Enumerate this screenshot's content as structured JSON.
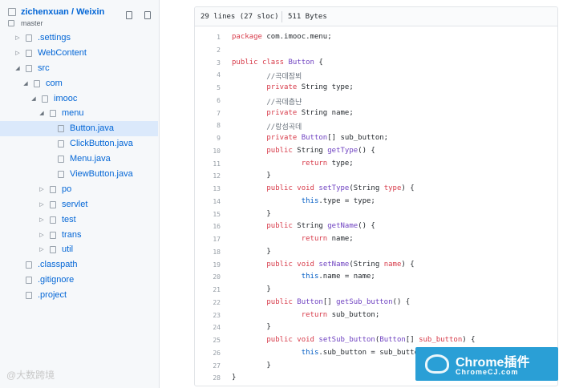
{
  "repo": {
    "title": "zichenxuan / Weixin",
    "branch": "master"
  },
  "tree": [
    {
      "label": ".settings",
      "toggle": "▷",
      "depth": 0
    },
    {
      "label": "WebContent",
      "toggle": "▷",
      "depth": 0
    },
    {
      "label": "src",
      "toggle": "◢",
      "depth": 0
    },
    {
      "label": "com",
      "toggle": "◢",
      "depth": 1
    },
    {
      "label": "imooc",
      "toggle": "◢",
      "depth": 2
    },
    {
      "label": "menu",
      "toggle": "◢",
      "depth": 3
    },
    {
      "label": "Button.java",
      "toggle": "",
      "depth": 4,
      "selected": true
    },
    {
      "label": "ClickButton.java",
      "toggle": "",
      "depth": 4
    },
    {
      "label": "Menu.java",
      "toggle": "",
      "depth": 4
    },
    {
      "label": "ViewButton.java",
      "toggle": "",
      "depth": 4
    },
    {
      "label": "po",
      "toggle": "▷",
      "depth": 3
    },
    {
      "label": "servlet",
      "toggle": "▷",
      "depth": 3
    },
    {
      "label": "test",
      "toggle": "▷",
      "depth": 3
    },
    {
      "label": "trans",
      "toggle": "▷",
      "depth": 3
    },
    {
      "label": "util",
      "toggle": "▷",
      "depth": 3
    },
    {
      "label": ".classpath",
      "toggle": "",
      "depth": 0
    },
    {
      "label": ".gitignore",
      "toggle": "",
      "depth": 0
    },
    {
      "label": ".project",
      "toggle": "",
      "depth": 0
    }
  ],
  "file": {
    "lines_info": "29 lines (27 sloc)",
    "size_info": "511 Bytes"
  },
  "code": [
    [
      [
        "kw",
        "package"
      ],
      [
        "tx",
        " com.imooc.menu;"
      ]
    ],
    [],
    [
      [
        "kw",
        "public"
      ],
      [
        "tx",
        " "
      ],
      [
        "kw",
        "class"
      ],
      [
        "tx",
        " "
      ],
      [
        "ty",
        "Button"
      ],
      [
        "tx",
        " {"
      ]
    ],
    [
      [
        "tx",
        "        "
      ],
      [
        "cm",
        "//곡데잠뵈"
      ]
    ],
    [
      [
        "tx",
        "        "
      ],
      [
        "kw",
        "private"
      ],
      [
        "tx",
        " String type;"
      ]
    ],
    [
      [
        "tx",
        "        "
      ],
      [
        "cm",
        "//곡데츰냔"
      ]
    ],
    [
      [
        "tx",
        "        "
      ],
      [
        "kw",
        "private"
      ],
      [
        "tx",
        " String name;"
      ]
    ],
    [
      [
        "tx",
        "        "
      ],
      [
        "cm",
        "//랑섬곡데"
      ]
    ],
    [
      [
        "tx",
        "        "
      ],
      [
        "kw",
        "private"
      ],
      [
        "tx",
        " "
      ],
      [
        "ty",
        "Button"
      ],
      [
        "tx",
        "[] sub_button;"
      ]
    ],
    [
      [
        "tx",
        "        "
      ],
      [
        "kw",
        "public"
      ],
      [
        "tx",
        " String "
      ],
      [
        "fn",
        "getType"
      ],
      [
        "tx",
        "() {"
      ]
    ],
    [
      [
        "tx",
        "                "
      ],
      [
        "kw",
        "return"
      ],
      [
        "tx",
        " type;"
      ]
    ],
    [
      [
        "tx",
        "        }"
      ]
    ],
    [
      [
        "tx",
        "        "
      ],
      [
        "kw",
        "public"
      ],
      [
        "tx",
        " "
      ],
      [
        "kw",
        "void"
      ],
      [
        "tx",
        " "
      ],
      [
        "fn",
        "setType"
      ],
      [
        "tx",
        "(String "
      ],
      [
        "kw",
        "type"
      ],
      [
        "tx",
        ") {"
      ]
    ],
    [
      [
        "tx",
        "                "
      ],
      [
        "id",
        "this"
      ],
      [
        "tx",
        ".type = type;"
      ]
    ],
    [
      [
        "tx",
        "        }"
      ]
    ],
    [
      [
        "tx",
        "        "
      ],
      [
        "kw",
        "public"
      ],
      [
        "tx",
        " String "
      ],
      [
        "fn",
        "getName"
      ],
      [
        "tx",
        "() {"
      ]
    ],
    [
      [
        "tx",
        "                "
      ],
      [
        "kw",
        "return"
      ],
      [
        "tx",
        " name;"
      ]
    ],
    [
      [
        "tx",
        "        }"
      ]
    ],
    [
      [
        "tx",
        "        "
      ],
      [
        "kw",
        "public"
      ],
      [
        "tx",
        " "
      ],
      [
        "kw",
        "void"
      ],
      [
        "tx",
        " "
      ],
      [
        "fn",
        "setName"
      ],
      [
        "tx",
        "(String "
      ],
      [
        "kw",
        "name"
      ],
      [
        "tx",
        ") {"
      ]
    ],
    [
      [
        "tx",
        "                "
      ],
      [
        "id",
        "this"
      ],
      [
        "tx",
        ".name = name;"
      ]
    ],
    [
      [
        "tx",
        "        }"
      ]
    ],
    [
      [
        "tx",
        "        "
      ],
      [
        "kw",
        "public"
      ],
      [
        "tx",
        " "
      ],
      [
        "ty",
        "Button"
      ],
      [
        "tx",
        "[] "
      ],
      [
        "fn",
        "getSub_button"
      ],
      [
        "tx",
        "() {"
      ]
    ],
    [
      [
        "tx",
        "                "
      ],
      [
        "kw",
        "return"
      ],
      [
        "tx",
        " sub_button;"
      ]
    ],
    [
      [
        "tx",
        "        }"
      ]
    ],
    [
      [
        "tx",
        "        "
      ],
      [
        "kw",
        "public"
      ],
      [
        "tx",
        " "
      ],
      [
        "kw",
        "void"
      ],
      [
        "tx",
        " "
      ],
      [
        "fn",
        "setSub_button"
      ],
      [
        "tx",
        "("
      ],
      [
        "ty",
        "Button"
      ],
      [
        "tx",
        "[] "
      ],
      [
        "kw",
        "sub_button"
      ],
      [
        "tx",
        ") {"
      ]
    ],
    [
      [
        "tx",
        "                "
      ],
      [
        "id",
        "this"
      ],
      [
        "tx",
        ".sub_button = sub_button;"
      ]
    ],
    [
      [
        "tx",
        "        }"
      ]
    ],
    [
      [
        "tx",
        "}"
      ]
    ]
  ],
  "watermarks": {
    "left": "@大数跨境",
    "right_brand": "Chrome插件",
    "right_url": "ChromeCJ.com"
  }
}
